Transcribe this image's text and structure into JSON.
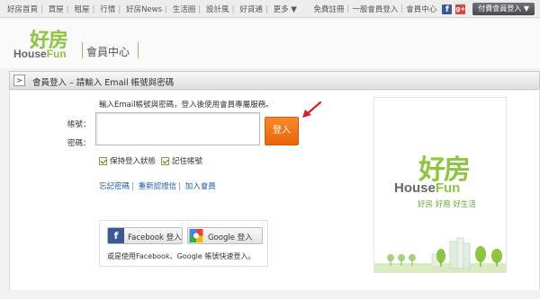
{
  "topnav": {
    "left_items": [
      "好房首頁",
      "買屋",
      "租屋",
      "行情",
      "好房News",
      "生活圈",
      "設計風",
      "好貸通",
      "更多 ▼"
    ],
    "right_items": [
      "免費註冊",
      "一般會員登入",
      "會員中心"
    ],
    "paid_login_label": "付費會員登入 ▼",
    "facebook_icon": "f",
    "google_plus_icon": "g+"
  },
  "header": {
    "logo_zh": "好房",
    "logo_en_a": "House",
    "logo_en_b": "Fun",
    "center_label": "會員中心"
  },
  "titlebar": {
    "arrow": ">",
    "text": "會員登入 – 請輸入 Email 帳號與密碼"
  },
  "form": {
    "instruction": "輸入Email帳號與密碼，登入後使用會員專屬服務。",
    "account_label": "帳號：",
    "password_label": "密碼：",
    "account_value": "",
    "password_value": "",
    "login_button": "登入",
    "keep_login_label": "保持登入狀態",
    "remember_account_label": "記住帳號"
  },
  "links": {
    "forgot_password": "忘記密碼",
    "resend_verification": "重新認證信",
    "join_member": "加入會員"
  },
  "social": {
    "facebook_icon": "f",
    "facebook_label": "Facebook 登入",
    "google_label": "Google 登入",
    "note": "或是使用Facebook、Google 帳號快速登入。"
  },
  "brand": {
    "logo_zh": "好房",
    "logo_en_a": "House",
    "logo_en_b": "Fun",
    "slogan": "好房 好窩 好生活"
  },
  "colors": {
    "brand_green": "#8cc63f",
    "login_orange": "#f07a1c",
    "link_blue": "#1a5aa8",
    "facebook_blue": "#3b5998",
    "arrow_red": "#d42222"
  }
}
